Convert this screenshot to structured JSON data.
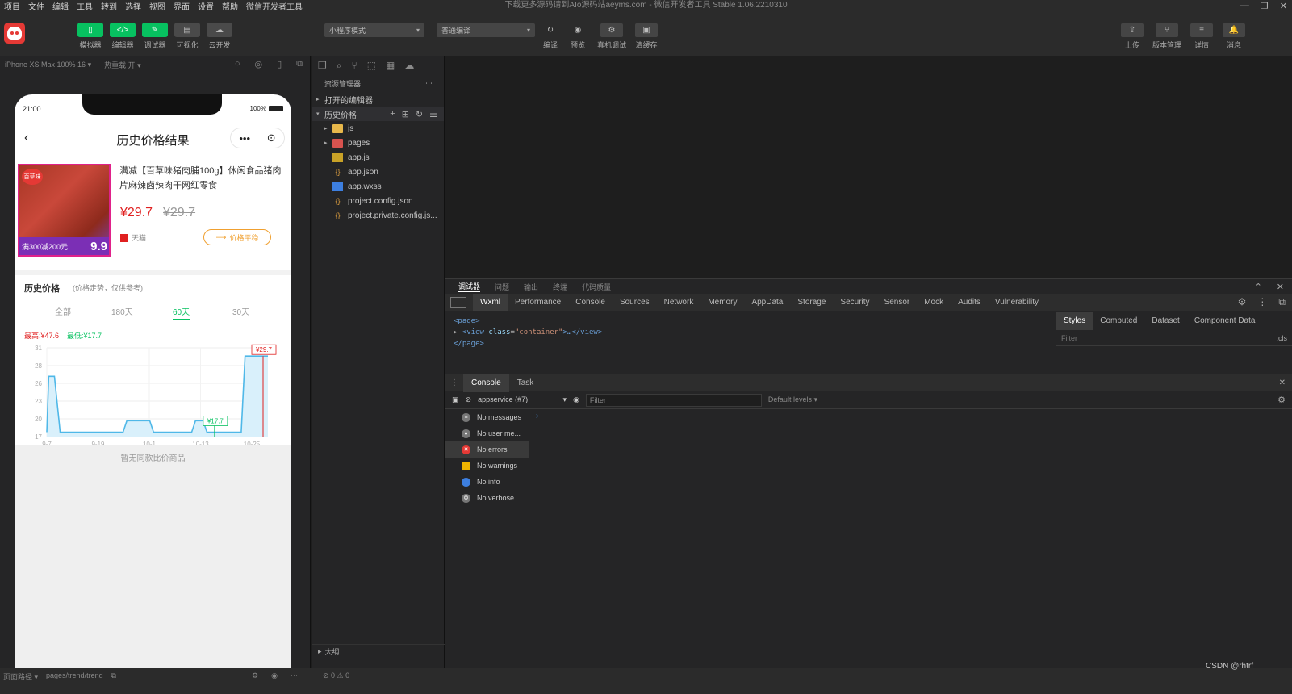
{
  "window": {
    "title": "下载更多源码请到AIo源码站aeyms.com - 微信开发者工具 Stable 1.06.2210310"
  },
  "menu": [
    "项目",
    "文件",
    "编辑",
    "工具",
    "转到",
    "选择",
    "视图",
    "界面",
    "设置",
    "帮助",
    "微信开发者工具"
  ],
  "toolbar": {
    "left_buttons": [
      {
        "label": "模拟器",
        "icon": "phone-icon",
        "style": "green",
        "glyph": "▯"
      },
      {
        "label": "编辑器",
        "icon": "code-icon",
        "style": "green",
        "glyph": "</>"
      },
      {
        "label": "调试器",
        "icon": "debug-icon",
        "style": "green",
        "glyph": "✎"
      },
      {
        "label": "可视化",
        "icon": "visual-icon",
        "style": "grey",
        "glyph": "▤"
      },
      {
        "label": "云开发",
        "icon": "cloud-icon",
        "style": "grey",
        "glyph": "☁"
      }
    ],
    "mode_select": "小程序模式",
    "compile_select": "普通编译",
    "center_buttons": [
      {
        "label": "编译",
        "icon": "refresh-icon",
        "glyph": "↻"
      },
      {
        "label": "预览",
        "icon": "eye-icon",
        "glyph": "◉"
      },
      {
        "label": "真机调试",
        "icon": "bug-icon",
        "glyph": "⚙"
      },
      {
        "label": "清缓存",
        "icon": "clear-cache-icon",
        "glyph": "▣"
      }
    ],
    "right_buttons": [
      {
        "label": "上传",
        "icon": "upload-icon",
        "glyph": "⇪"
      },
      {
        "label": "版本管理",
        "icon": "branch-icon",
        "glyph": "⑂"
      },
      {
        "label": "详情",
        "icon": "details-icon",
        "glyph": "≡"
      },
      {
        "label": "消息",
        "icon": "bell-icon",
        "glyph": "🔔"
      }
    ]
  },
  "simulator": {
    "device": "iPhone XS Max 100% 16 ▾",
    "hotreload": "热重载 开 ▾",
    "status_time": "21:00",
    "battery": "100%"
  },
  "app_page": {
    "title": "历史价格结果",
    "capsule_more": "•••",
    "capsule_close": "⊙",
    "product": {
      "brand": "百草味",
      "promo": "满300减200元",
      "img_price": "9.9",
      "name": "满减【百草味猪肉脯100g】休闲食品猪肉片麻辣卤辣肉干网红零食",
      "price": "¥29.7",
      "old_price": "¥29.7",
      "shop": "天猫",
      "price_status": "价格平稳"
    },
    "history": {
      "title": "历史价格",
      "subtitle": "(价格走势，仅供参考)",
      "tabs": [
        "全部",
        "180天",
        "60天",
        "30天"
      ],
      "active_tab": 2,
      "highest": "最高:¥47.6",
      "lowest": "最低:¥17.7"
    },
    "no_compare": "暂无同款比价商品"
  },
  "chart_data": {
    "type": "line",
    "title": "",
    "xlabel": "",
    "ylabel": "",
    "x_tick_labels": [
      "9-7",
      "9-19",
      "10-1",
      "10-13",
      "10-25"
    ],
    "y_tick_labels": [
      "31",
      "28",
      "26",
      "23",
      "20",
      "17"
    ],
    "ylim": [
      17,
      31
    ],
    "series": [
      {
        "points": [
          {
            "x": 0,
            "y": 17.7
          },
          {
            "x": 0.5,
            "y": 26.5
          },
          {
            "x": 2,
            "y": 26.5
          },
          {
            "x": 3.5,
            "y": 17.7
          },
          {
            "x": 20,
            "y": 17.7
          },
          {
            "x": 21,
            "y": 19.5
          },
          {
            "x": 27,
            "y": 19.5
          },
          {
            "x": 28,
            "y": 17.7
          },
          {
            "x": 38,
            "y": 17.7
          },
          {
            "x": 39,
            "y": 19.5
          },
          {
            "x": 41,
            "y": 19.5
          },
          {
            "x": 42,
            "y": 17.7
          },
          {
            "x": 51,
            "y": 17.7
          },
          {
            "x": 52,
            "y": 29.7
          },
          {
            "x": 58,
            "y": 29.7
          }
        ]
      }
    ],
    "annotations": {
      "current_price_label": "¥29.7",
      "low_price_label": "¥17.7"
    },
    "grid": true,
    "colors": {
      "line": "#4fb8e8",
      "fill": "#d9f0fb",
      "marker_hi": "#e02020",
      "marker_lo": "#07c160"
    }
  },
  "explorer": {
    "header": "资源管理器",
    "open_editors": "打开的编辑器",
    "project": "历史价格",
    "files": [
      {
        "name": "js",
        "type": "folder",
        "expandable": true
      },
      {
        "name": "pages",
        "type": "folder-red",
        "expandable": true
      },
      {
        "name": "app.js",
        "type": "js"
      },
      {
        "name": "app.json",
        "type": "json"
      },
      {
        "name": "app.wxss",
        "type": "wxss"
      },
      {
        "name": "project.config.json",
        "type": "json"
      },
      {
        "name": "project.private.config.js...",
        "type": "json"
      }
    ],
    "outline": "大纲"
  },
  "debugger": {
    "panel_tabs": [
      "调试器",
      "问题",
      "输出",
      "终端",
      "代码质量"
    ],
    "dev_tabs": [
      "Wxml",
      "Performance",
      "Console",
      "Sources",
      "Network",
      "Memory",
      "AppData",
      "Storage",
      "Security",
      "Sensor",
      "Mock",
      "Audits",
      "Vulnerability"
    ],
    "elements": {
      "line1": "<page>",
      "line2_tag": "<view",
      "line2_attr": "class",
      "line2_val": "\"container\"",
      "line2_end": ">…</view>",
      "line3": "</page>"
    },
    "style_tabs": [
      "Styles",
      "Computed",
      "Dataset",
      "Component Data"
    ],
    "styles_filter": "Filter",
    "cls": ".cls",
    "console_tabs": [
      "Console",
      "Task"
    ],
    "context": "appservice (#7)",
    "filter_placeholder": "Filter",
    "levels": "Default levels ▾",
    "sidebar": [
      {
        "label": "No messages",
        "icon": "list-icon",
        "color": "#777"
      },
      {
        "label": "No user me...",
        "icon": "user-icon",
        "color": "#777"
      },
      {
        "label": "No errors",
        "icon": "error-icon",
        "color": "#e53935"
      },
      {
        "label": "No warnings",
        "icon": "warning-icon",
        "color": "#f0b400"
      },
      {
        "label": "No info",
        "icon": "info-icon",
        "color": "#3d7fe0"
      },
      {
        "label": "No verbose",
        "icon": "verbose-icon",
        "color": "#777"
      }
    ],
    "prompt": "›"
  },
  "statusbar": {
    "page_path_label": "页面路径 ▾",
    "page_path": "pages/trend/trend",
    "errors": "⊘ 0 ⚠ 0",
    "credit": "CSDN @rhtrf"
  }
}
